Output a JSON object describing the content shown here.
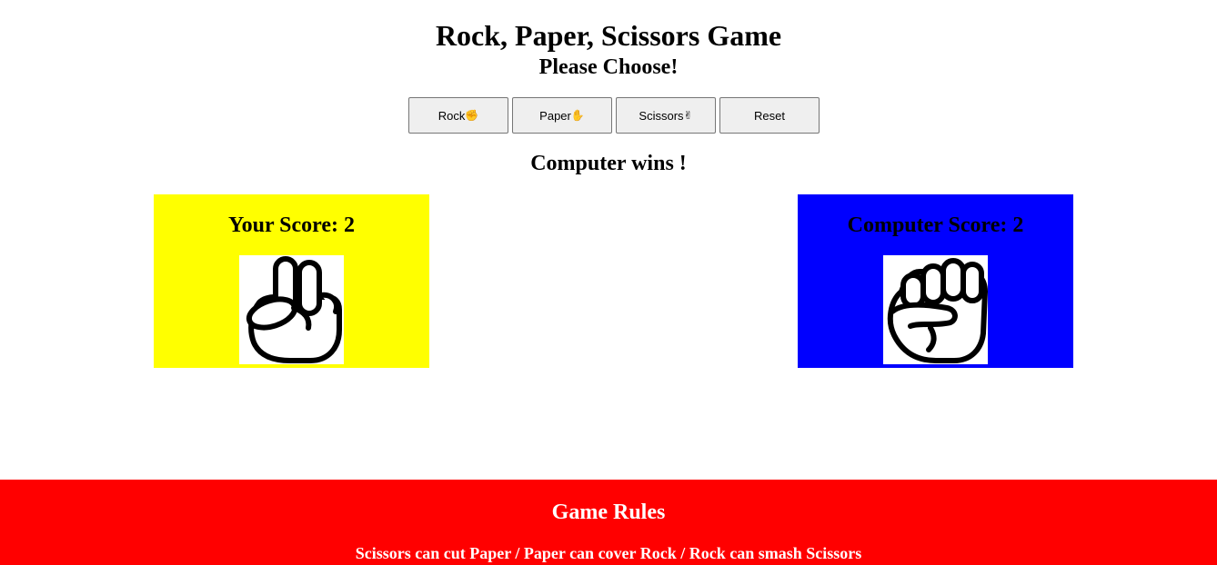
{
  "header": {
    "title": "Rock, Paper, Scissors Game",
    "subtitle": "Please Choose!"
  },
  "buttons": {
    "rock_label": "Rock",
    "rock_emoji": "✊",
    "paper_label": "Paper",
    "paper_emoji": "✋",
    "scissors_label": "Scissors",
    "scissors_emoji": "✌",
    "reset_label": "Reset"
  },
  "result": {
    "text": "Computer wins !"
  },
  "player": {
    "score_label": "Your Score: 2",
    "choice_icon": "scissors-hand-icon",
    "box_color": "#ffff00"
  },
  "computer": {
    "score_label": "Computer Score: 2",
    "choice_icon": "rock-fist-icon",
    "box_color": "#0000ff"
  },
  "footer": {
    "title": "Game Rules",
    "rules": "Scissors can cut Paper / Paper can cover Rock / Rock can smash Scissors",
    "background": "#ff0000"
  }
}
